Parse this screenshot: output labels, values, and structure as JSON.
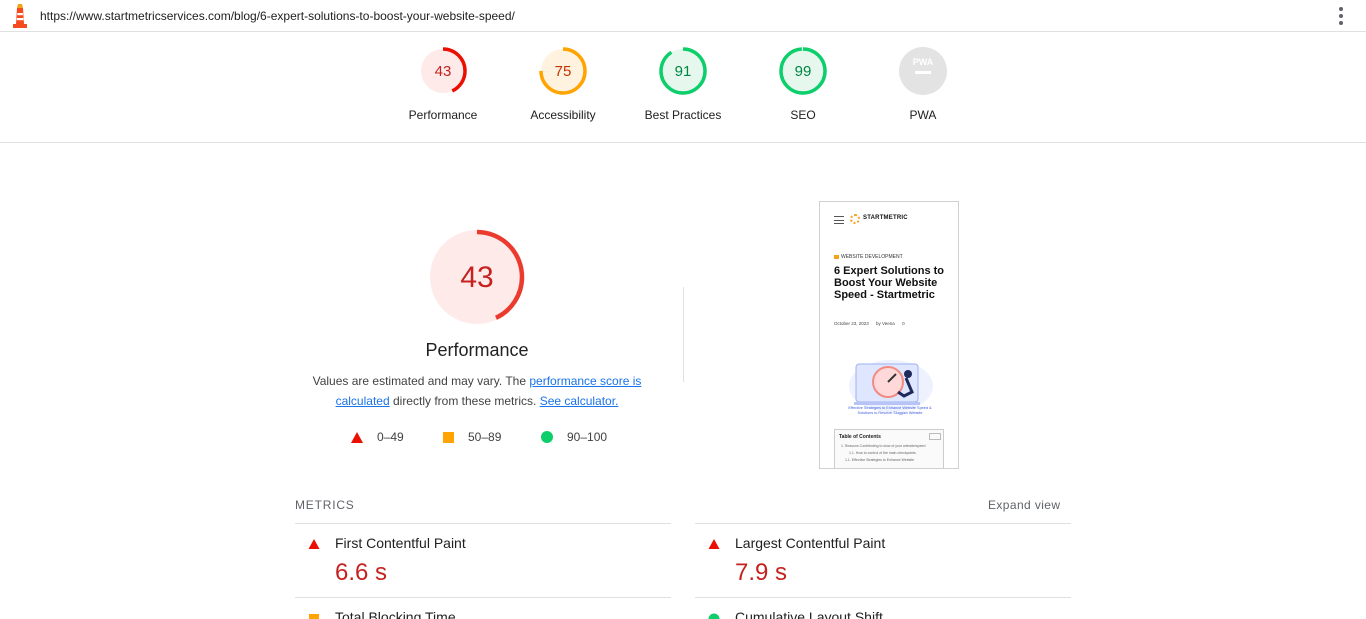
{
  "topbar": {
    "url": "https://www.startmetricservices.com/blog/6-expert-solutions-to-boost-your-website-speed/",
    "logo_icon": "lighthouse-icon",
    "menu_icon": "kebab-menu-icon"
  },
  "summary": {
    "categories": [
      {
        "label": "Performance",
        "score": "43",
        "fraction": 0.43,
        "status": "fail"
      },
      {
        "label": "Accessibility",
        "score": "75",
        "fraction": 0.75,
        "status": "average"
      },
      {
        "label": "Best Practices",
        "score": "91",
        "fraction": 0.91,
        "status": "pass"
      },
      {
        "label": "SEO",
        "score": "99",
        "fraction": 0.99,
        "status": "pass"
      },
      {
        "label": "PWA",
        "score": "",
        "fraction": 0,
        "status": "na"
      }
    ]
  },
  "performance": {
    "score": "43",
    "fraction": 0.43,
    "title": "Performance",
    "desc_prefix": "Values are estimated and may vary. The ",
    "desc_link1": "performance score is calculated",
    "desc_middle": " directly from these metrics. ",
    "desc_link2": "See calculator."
  },
  "legend": {
    "fail": "0–49",
    "average": "50–89",
    "pass": "90–100"
  },
  "thumbnail": {
    "brand": "STARTMETRIC",
    "category": "WEBSITE DEVELOPMENT",
    "title": "6 Expert Solutions to Boost Your Website Speed - Startmetric",
    "date": "October 23, 2023",
    "author": "by Veena",
    "comments": "0",
    "caption": "Effective Strategies to Enhance Website Speed & Solutions to Resolve Sluggish Website",
    "toc_heading": "Table of Contents",
    "toc_lines": [
      "1. Reasons Contributing to slow of your website/speed",
      "1.1. How to control of the main checkpoints",
      "1.1. Effective Strategies to Enhance Website"
    ]
  },
  "metrics": {
    "heading": "METRICS",
    "expand_label": "Expand view",
    "items": [
      {
        "title": "First Contentful Paint",
        "value": "6.6 s",
        "status": "fail"
      },
      {
        "title": "Largest Contentful Paint",
        "value": "7.9 s",
        "status": "fail"
      },
      {
        "title": "Total Blocking Time",
        "value": "",
        "status": "average"
      },
      {
        "title": "Cumulative Layout Shift",
        "value": "",
        "status": "pass"
      }
    ]
  },
  "colors": {
    "fail": "#eb0f00",
    "fail_text": "#c5221f",
    "fail_bg": "#ffeaea",
    "average": "#ffa400",
    "average_text": "#c33300",
    "average_bg": "#fff3e0",
    "pass": "#0cce6b",
    "pass_text": "#018642",
    "pass_bg": "#e6f7ee",
    "na": "#c8c8c8",
    "link": "#1a73e8"
  }
}
